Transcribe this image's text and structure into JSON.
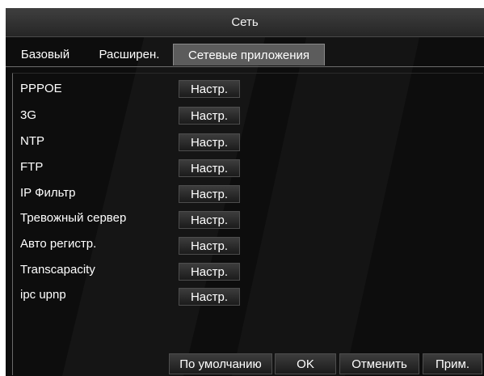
{
  "window": {
    "title": "Сеть"
  },
  "tabs": [
    {
      "label": "Базовый",
      "active": false
    },
    {
      "label": "Расширен.",
      "active": false
    },
    {
      "label": "Сетевые приложения",
      "active": true
    }
  ],
  "settings": [
    {
      "label": "PPPOE",
      "button": "Настр."
    },
    {
      "label": "3G",
      "button": "Настр."
    },
    {
      "label": "NTP",
      "button": "Настр."
    },
    {
      "label": "FTP",
      "button": "Настр."
    },
    {
      "label": "IP Фильтр",
      "button": "Настр."
    },
    {
      "label": "Тревожный сервер",
      "button": "Настр."
    },
    {
      "label": "Авто регистр.",
      "button": "Настр."
    },
    {
      "label": "Transcapacity",
      "button": "Настр."
    },
    {
      "label": "ipc upnp",
      "button": "Настр."
    }
  ],
  "footer": {
    "default_label": "По умолчанию",
    "ok_label": "OK",
    "cancel_label": "Отменить",
    "apply_label": "Прим."
  },
  "colors": {
    "background": "#0d0d0d",
    "active_tab": "#5c5c5c",
    "text": "#ffffff"
  }
}
